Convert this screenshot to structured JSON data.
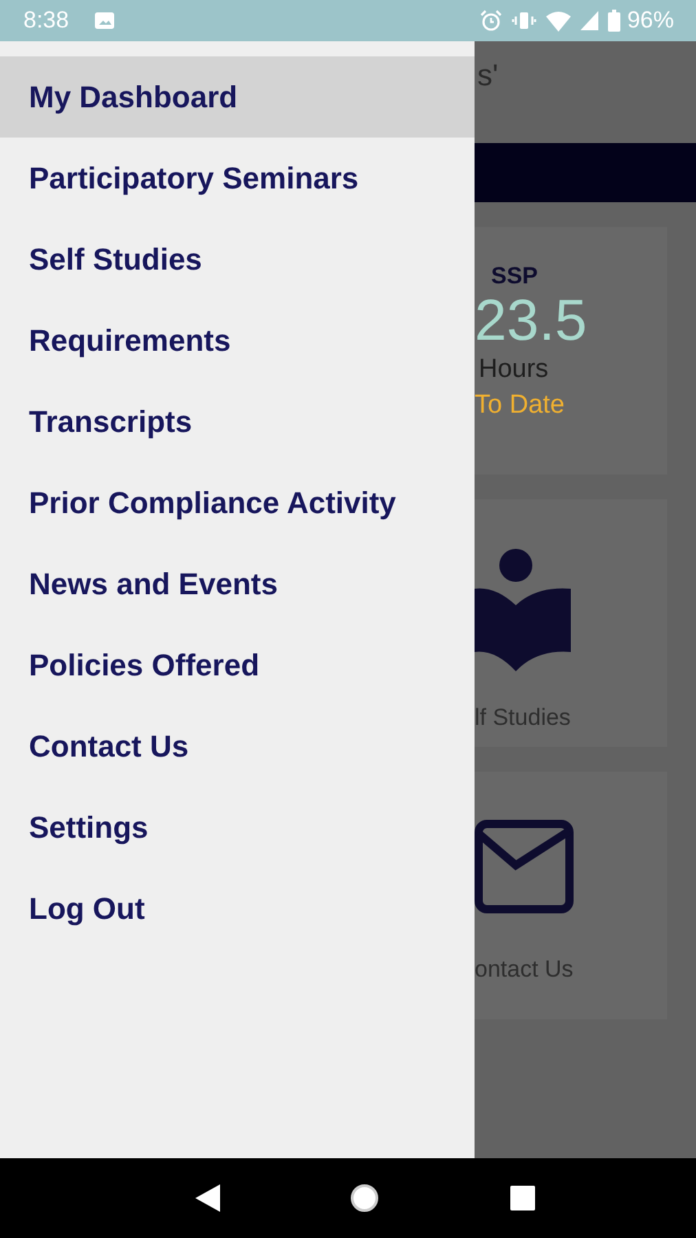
{
  "status_bar": {
    "time": "8:38",
    "battery": "96%"
  },
  "drawer": {
    "items": [
      {
        "label": "My Dashboard",
        "selected": true
      },
      {
        "label": "Participatory Seminars",
        "selected": false
      },
      {
        "label": "Self Studies",
        "selected": false
      },
      {
        "label": "Requirements",
        "selected": false
      },
      {
        "label": "Transcripts",
        "selected": false
      },
      {
        "label": "Prior Compliance Activity",
        "selected": false
      },
      {
        "label": "News and Events",
        "selected": false
      },
      {
        "label": "Policies Offered",
        "selected": false
      },
      {
        "label": "Contact Us",
        "selected": false
      },
      {
        "label": "Settings",
        "selected": false
      },
      {
        "label": "Log Out",
        "selected": false
      }
    ]
  },
  "background": {
    "title": "s'",
    "cards": [
      {
        "kind": "stat",
        "title": "SSP",
        "value": "23.5",
        "unit": "Hours",
        "caption": "To Date"
      },
      {
        "kind": "book",
        "label": "lf Studies"
      },
      {
        "kind": "mail",
        "label": "ontact Us"
      }
    ]
  }
}
